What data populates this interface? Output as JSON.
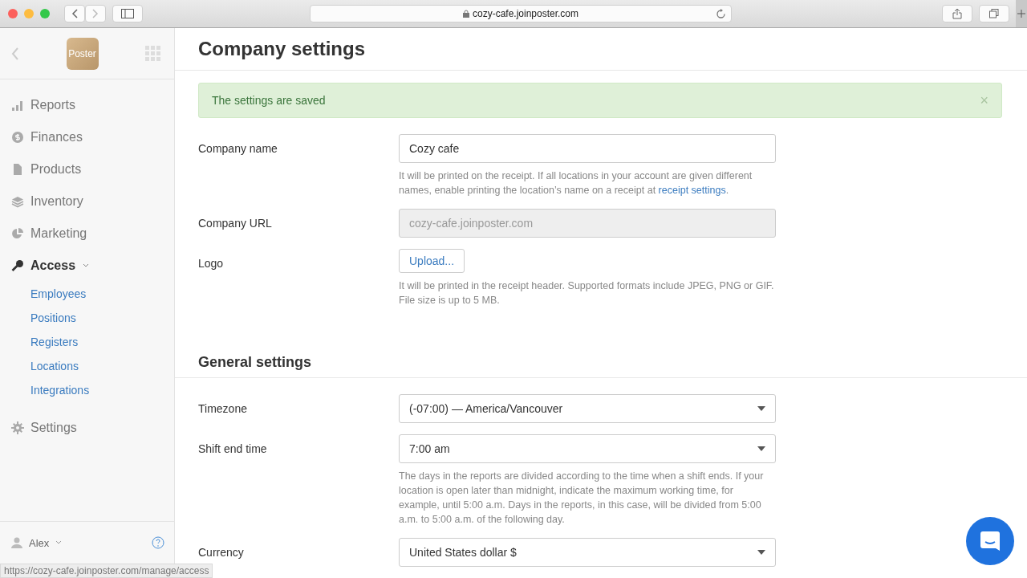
{
  "browser": {
    "url": "cozy-cafe.joinposter.com"
  },
  "sidebar": {
    "logo": "Poster",
    "items": [
      {
        "kind": "bars",
        "label": "Reports",
        "selected": false
      },
      {
        "kind": "coin",
        "label": "Finances",
        "selected": false
      },
      {
        "kind": "file",
        "label": "Products",
        "selected": false
      },
      {
        "kind": "layers",
        "label": "Inventory",
        "selected": false
      },
      {
        "kind": "pie",
        "label": "Marketing",
        "selected": false
      },
      {
        "kind": "key",
        "label": "Access",
        "selected": true,
        "expanded": true,
        "children": [
          {
            "label": "Employees"
          },
          {
            "label": "Positions"
          },
          {
            "label": "Registers"
          },
          {
            "label": "Locations"
          },
          {
            "label": "Integrations"
          }
        ]
      },
      {
        "kind": "gear",
        "label": "Settings",
        "selected": false
      }
    ],
    "user": "Alex"
  },
  "page": {
    "title": "Company settings",
    "alert": "The settings are saved",
    "alert_close": "×",
    "sections": [
      {
        "rows": [
          {
            "kind": "text",
            "label": "Company name",
            "value": "Cozy cafe",
            "hint": "It will be printed on the receipt. If all locations in your account are given different names, enable printing the location’s name on a receipt at ",
            "link": "receipt settings",
            "hint_end": "."
          },
          {
            "kind": "readonly",
            "label": "Company URL",
            "value": "cozy-cafe.joinposter.com"
          },
          {
            "kind": "upload",
            "label": "Logo",
            "value": "Upload...",
            "hint": "It will be printed in the receipt header. Supported formats include JPEG, PNG or GIF. File size is up to 5 MB."
          }
        ]
      },
      {
        "title": "General settings",
        "rows": [
          {
            "kind": "select",
            "label": "Timezone",
            "value": "(-07:00) — America/Vancouver"
          },
          {
            "kind": "select",
            "label": "Shift end time",
            "value": "7:00 am",
            "hint": "The days in the reports are divided according to the time when a shift ends. If your location is open later than midnight, indicate the maximum working time, for example, until 5:00 a.m. Days in the reports, in this case, will be divided from 5:00 a.m. to 5:00 a.m. of the following day."
          },
          {
            "kind": "select",
            "label": "Currency",
            "value": "United States dollar $"
          }
        ]
      }
    ]
  },
  "status_bar": "https://cozy-cafe.joinposter.com/manage/access"
}
